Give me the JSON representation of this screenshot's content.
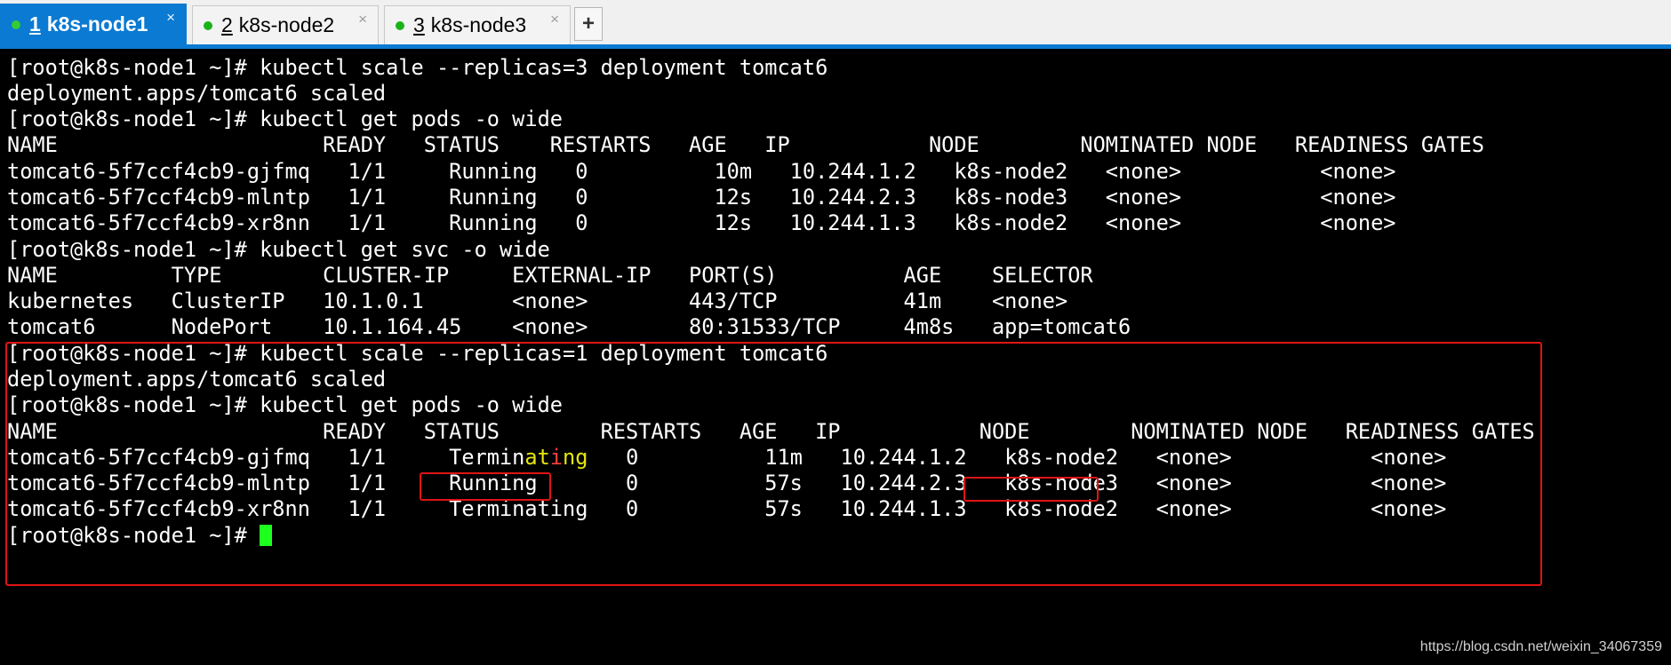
{
  "tabs": [
    {
      "number": "1",
      "label": "k8s-node1",
      "active": true
    },
    {
      "number": "2",
      "label": "k8s-node2",
      "active": false
    },
    {
      "number": "3",
      "label": "k8s-node3",
      "active": false
    }
  ],
  "tab_close_glyph": "×",
  "tab_add_glyph": "+",
  "terminal": {
    "lines": [
      "[root@k8s-node1 ~]# kubectl scale --replicas=3 deployment tomcat6",
      "deployment.apps/tomcat6 scaled",
      "[root@k8s-node1 ~]# kubectl get pods -o wide",
      "NAME                     READY   STATUS    RESTARTS   AGE   IP           NODE        NOMINATED NODE   READINESS GATES",
      "tomcat6-5f7ccf4cb9-gjfmq   1/1     Running   0          10m   10.244.1.2   k8s-node2   <none>           <none>",
      "tomcat6-5f7ccf4cb9-mlntp   1/1     Running   0          12s   10.244.2.3   k8s-node3   <none>           <none>",
      "tomcat6-5f7ccf4cb9-xr8nn   1/1     Running   0          12s   10.244.1.3   k8s-node2   <none>           <none>",
      "[root@k8s-node1 ~]# kubectl get svc -o wide",
      "NAME         TYPE        CLUSTER-IP     EXTERNAL-IP   PORT(S)          AGE    SELECTOR",
      "kubernetes   ClusterIP   10.1.0.1       <none>        443/TCP          41m    <none>",
      "tomcat6      NodePort    10.1.164.45    <none>        80:31533/TCP     4m8s   app=tomcat6",
      "[root@k8s-node1 ~]# kubectl scale --replicas=1 deployment tomcat6",
      "deployment.apps/tomcat6 scaled",
      "[root@k8s-node1 ~]# kubectl get pods -o wide",
      "NAME                     READY   STATUS        RESTARTS   AGE   IP           NODE        NOMINATED NODE   READINESS GATES",
      {
        "pre": "tomcat6-5f7ccf4cb9-gjfmq   1/1     Termin",
        "mid1": "at",
        "mid2": "i",
        "mid3": "ng",
        "post": "   0          11m   10.244.1.2   k8s-node2   <none>           <none>"
      },
      "tomcat6-5f7ccf4cb9-mlntp   1/1     Running       0          57s   10.244.2.3   k8s-node3   <none>           <none>",
      "tomcat6-5f7ccf4cb9-xr8nn   1/1     Terminating   0          57s   10.244.1.3   k8s-node2   <none>           <none>",
      "[root@k8s-node1 ~]# "
    ]
  },
  "colors": {
    "active_tab": "#0a7ad2",
    "status_dot": "#19b319",
    "cursor": "#1dff1d",
    "highlight_box": "#e01414",
    "yellow_text": "#e5e510"
  },
  "watermark": "https://blog.csdn.net/weixin_34067359"
}
